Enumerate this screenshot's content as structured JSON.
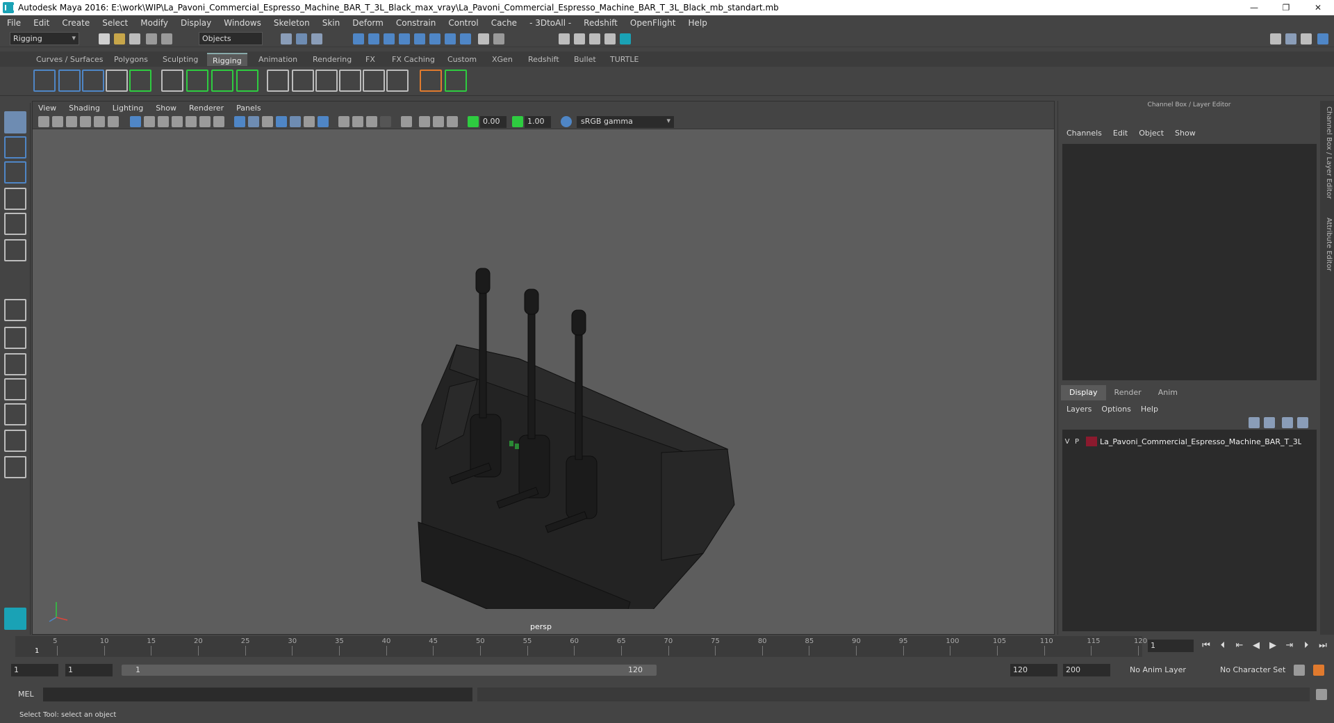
{
  "window": {
    "title": "Autodesk Maya 2016: E:\\work\\WIP\\La_Pavoni_Commercial_Espresso_Machine_BAR_T_3L_Black_max_vray\\La_Pavoni_Commercial_Espresso_Machine_BAR_T_3L_Black_mb_standart.mb",
    "minimize": "—",
    "restore": "❐",
    "close": "✕"
  },
  "menubar": [
    "File",
    "Edit",
    "Create",
    "Select",
    "Modify",
    "Display",
    "Windows",
    "Skeleton",
    "Skin",
    "Deform",
    "Constrain",
    "Control",
    "Cache",
    "- 3DtoAll -",
    "Redshift",
    "OpenFlight",
    "Help"
  ],
  "status_line": {
    "mode": "Rigging",
    "selection_mask": "Objects"
  },
  "shelf": {
    "tabs": [
      "Curves / Surfaces",
      "Polygons",
      "Sculpting",
      "Rigging",
      "Animation",
      "Rendering",
      "FX",
      "FX Caching",
      "Custom",
      "XGen",
      "Redshift",
      "Bullet",
      "TURTLE"
    ],
    "active_tab": "Rigging"
  },
  "viewport": {
    "menu": [
      "View",
      "Shading",
      "Lighting",
      "Show",
      "Renderer",
      "Panels"
    ],
    "exposure": "0.00",
    "gamma": "1.00",
    "color_space": "sRGB gamma",
    "camera": "persp"
  },
  "channel_box": {
    "title": "Channel Box / Layer Editor",
    "menu": [
      "Channels",
      "Edit",
      "Object",
      "Show"
    ]
  },
  "layer_editor": {
    "tabs": [
      "Display",
      "Render",
      "Anim"
    ],
    "active_tab": "Display",
    "menu": [
      "Layers",
      "Options",
      "Help"
    ],
    "layers": [
      {
        "visible": "V",
        "playback": "P",
        "color": "#8b1a2e",
        "name": "La_Pavoni_Commercial_Espresso_Machine_BAR_T_3L_Black"
      }
    ]
  },
  "side_tabs": [
    "Channel Box / Layer Editor",
    "Attribute Editor"
  ],
  "time_slider": {
    "ticks": [
      "5",
      "10",
      "15",
      "20",
      "25",
      "30",
      "35",
      "40",
      "45",
      "50",
      "55",
      "60",
      "65",
      "70",
      "75",
      "80",
      "85",
      "90",
      "95",
      "100",
      "105",
      "110",
      "115",
      "120"
    ],
    "current_marker": "1",
    "current_frame": "1"
  },
  "range_slider": {
    "start": "1",
    "playback_start": "1",
    "bar_start": "1",
    "bar_end": "120",
    "playback_end": "120",
    "end": "200",
    "anim_layer": "No Anim Layer",
    "character_set": "No Character Set"
  },
  "command_line": {
    "language": "MEL"
  },
  "help_line": {
    "text": "Select Tool: select an object"
  },
  "colors": {
    "accent": "#6e8cb2",
    "rig_green": "#2ecc40",
    "layer_red": "#8b1a2e"
  }
}
